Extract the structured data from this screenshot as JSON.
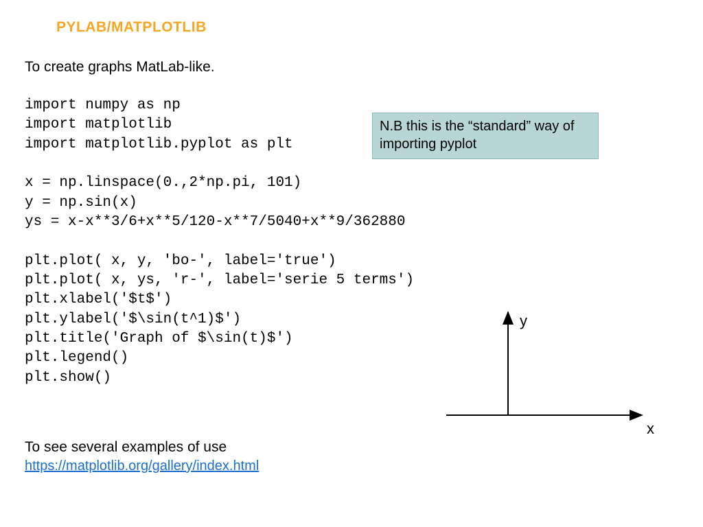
{
  "title": "PYLAB/MATPLOTLIB",
  "intro": "To create graphs MatLab-like.",
  "code": "import numpy as np\nimport matplotlib\nimport matplotlib.pyplot as plt\n\nx = np.linspace(0.,2*np.pi, 101)\ny = np.sin(x)\nys = x-x**3/6+x**5/120-x**7/5040+x**9/362880\n\nplt.plot( x, y, 'bo-', label='true')\nplt.plot( x, ys, 'r-', label='serie 5 terms')\nplt.xlabel('$t$')\nplt.ylabel('$\\sin(t^1)$')\nplt.title('Graph of $\\sin(t)$')\nplt.legend()\nplt.show()",
  "note": "N.B this is the “standard” way of importing pyplot",
  "axes": {
    "y_label": "y",
    "x_label": "x"
  },
  "footer": {
    "text": "To see several examples of use",
    "link": "https://matplotlib.org/gallery/index.html"
  }
}
